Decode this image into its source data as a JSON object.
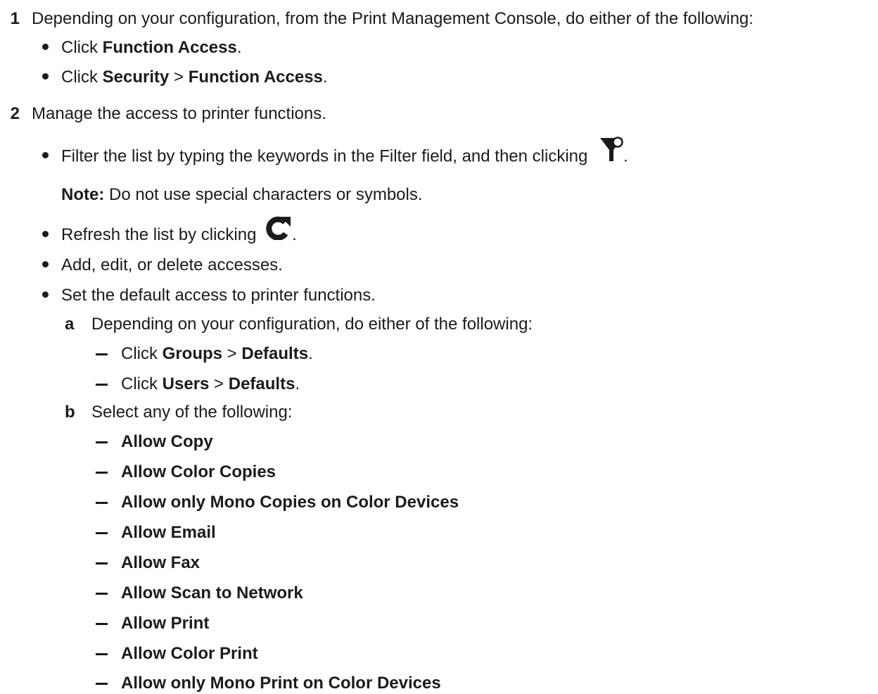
{
  "steps": [
    {
      "number": "1",
      "text": "Depending on your configuration, from the Print Management Console, do either of the following:",
      "bullets": [
        {
          "pre": "Click ",
          "b1": "Function Access",
          "post": "."
        },
        {
          "pre": "Click ",
          "b1": "Security",
          "sep": " > ",
          "b2": "Function Access",
          "post": "."
        }
      ]
    },
    {
      "number": "2",
      "text": "Manage the access to printer functions.",
      "filter_bullet": {
        "pre": "Filter the list by typing the keywords in the Filter field, and then clicking ",
        "post": "."
      },
      "note": {
        "label": "Note:",
        "text": " Do not use special characters or symbols."
      },
      "refresh_bullet": {
        "pre": "Refresh the list by clicking ",
        "post": "."
      },
      "add_bullet": "Add, edit, or delete accesses.",
      "default_bullet": "Set the default access to printer functions.",
      "substeps": [
        {
          "letter": "a",
          "text": "Depending on your configuration, do either of the following:",
          "items": [
            {
              "pre": "Click ",
              "b1": "Groups",
              "sep": " > ",
              "b2": "Defaults",
              "post": "."
            },
            {
              "pre": "Click ",
              "b1": "Users",
              "sep": " > ",
              "b2": "Defaults",
              "post": "."
            }
          ]
        },
        {
          "letter": "b",
          "text": "Select any of the following:",
          "options": [
            "Allow Copy",
            "Allow Color Copies",
            "Allow only Mono Copies on Color Devices",
            "Allow Email",
            "Allow Fax",
            "Allow Scan to Network",
            "Allow Print",
            "Allow Color Print",
            "Allow only Mono Print on Color Devices"
          ]
        }
      ]
    }
  ],
  "icons": {
    "filter": "filter-icon",
    "refresh": "refresh-icon"
  }
}
